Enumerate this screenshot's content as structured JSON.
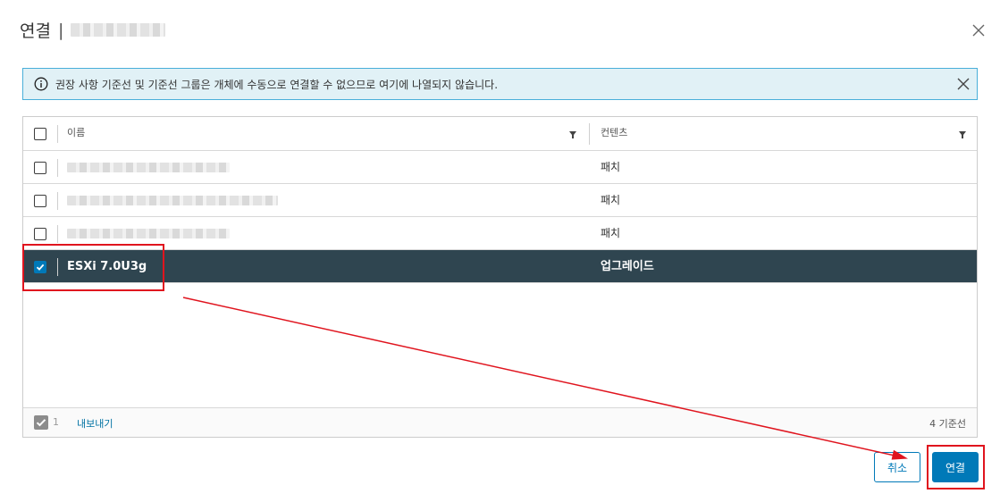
{
  "dialog": {
    "title": "연결",
    "separator": "|"
  },
  "alert": {
    "message": "권장 사항 기준선 및 기준선 그룹은 개체에 수동으로 연결할 수 없으므로 여기에 나열되지 않습니다."
  },
  "grid": {
    "columns": {
      "name": "이름",
      "content": "컨텐츠"
    },
    "rows": [
      {
        "name": "",
        "content": "패치",
        "selected": false
      },
      {
        "name": "",
        "content": "패치",
        "selected": false
      },
      {
        "name": "",
        "content": "패치",
        "selected": false
      },
      {
        "name": "ESXi 7.0U3g",
        "content": "업그레이드",
        "selected": true
      }
    ],
    "footer": {
      "selected_count": "1",
      "export_label": "내보내기",
      "total_label": "4 기준선"
    }
  },
  "buttons": {
    "cancel": "취소",
    "connect": "연결"
  },
  "colors": {
    "primary": "#0079b8",
    "selected_row": "#2f4550",
    "alert_bg": "#e1f1f6",
    "annotation": "#e0141e"
  },
  "icons": {
    "close": "close-icon",
    "info": "info-icon",
    "filter": "filter-icon",
    "check": "checkmark-icon"
  }
}
